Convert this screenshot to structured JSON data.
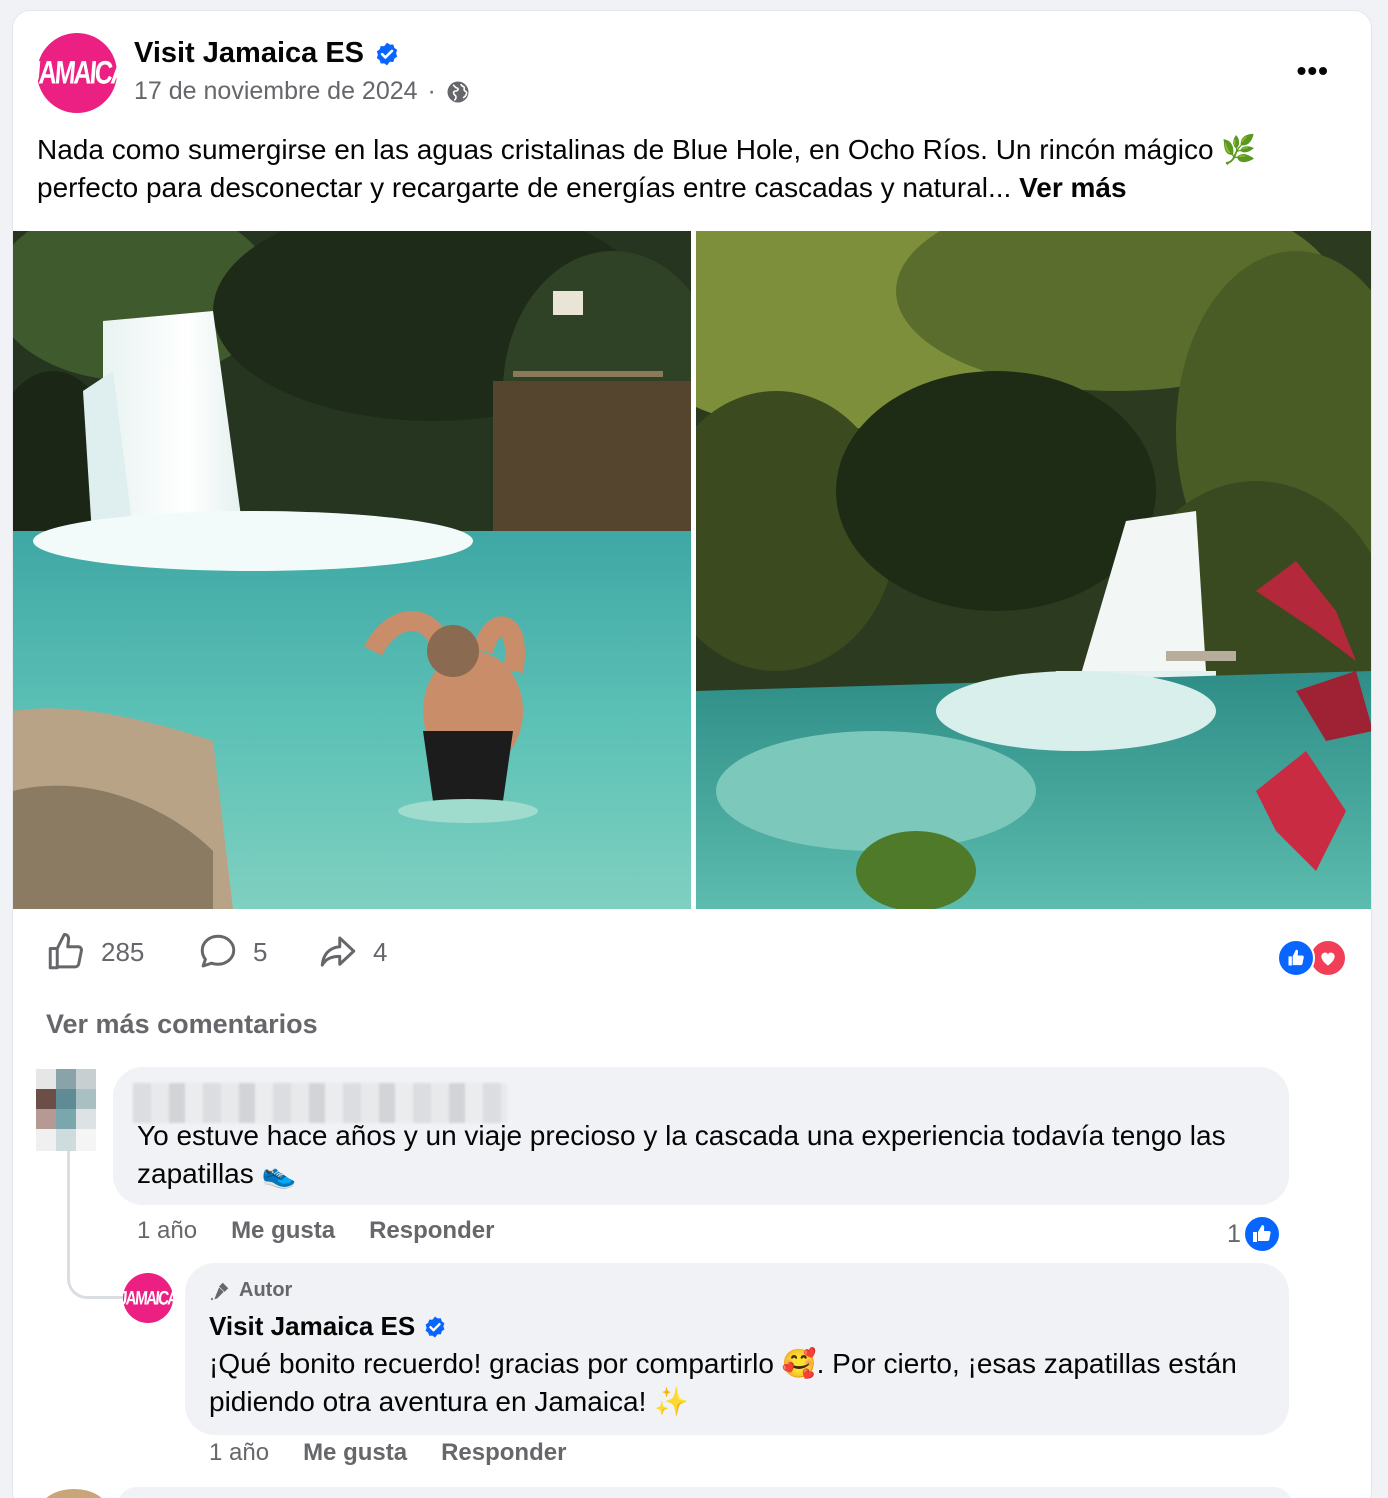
{
  "post": {
    "page_name": "Visit Jamaica ES",
    "logo_text": "JAMAICA",
    "date": "17 de noviembre de 2024",
    "separator": "·",
    "text": "Nada como sumergirse en las aguas cristalinas de Blue Hole, en Ocho Ríos. Un rincón mágico 🌿 perfecto para desconectar y recargarte de energías entre cascadas y natural...",
    "see_more": "Ver más",
    "more_menu": "•••"
  },
  "actions": {
    "likes": "285",
    "comments": "5",
    "shares": "4"
  },
  "comments_section": {
    "view_more": "Ver más comentarios"
  },
  "comments": [
    {
      "text": "Yo estuve hace años y un viaje precioso y la cascada una experiencia todavía tengo las zapatillas 👟",
      "time": "1 año",
      "like": "Me gusta",
      "reply": "Responder",
      "like_count": "1"
    }
  ],
  "reply": {
    "author_tag": "Autor",
    "author": "Visit Jamaica ES",
    "logo_text": "JAMAICA",
    "text": "¡Qué bonito recuerdo! gracias por compartirlo 🥰. Por cierto, ¡esas zapatillas están pidiendo otra aventura en Jamaica! ✨",
    "time": "1 año",
    "like": "Me gusta",
    "reply": "Responder"
  },
  "colors": {
    "brand_pink": "#ec1f83",
    "fb_blue": "#0866ff",
    "love_red": "#f33e58",
    "muted": "#65676b"
  }
}
